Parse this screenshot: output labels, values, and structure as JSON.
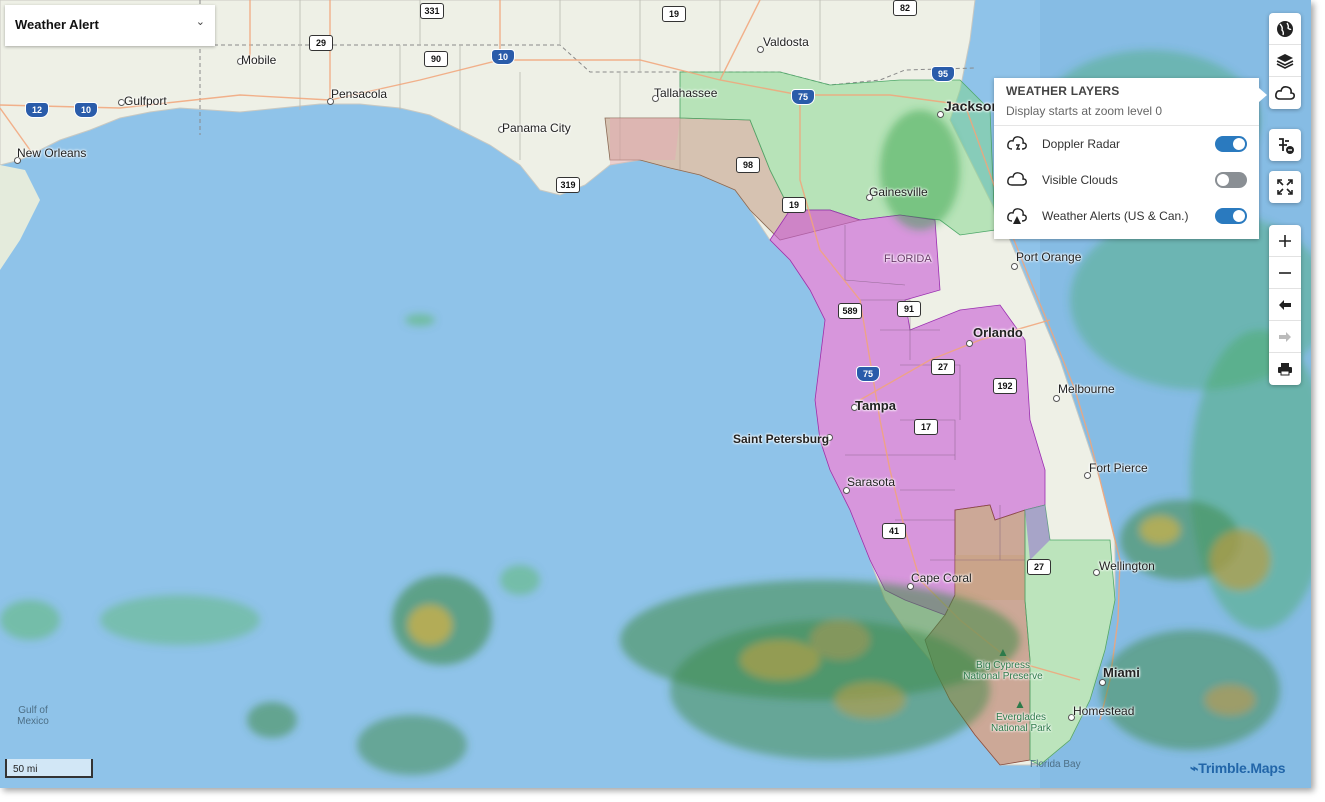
{
  "layer_select": {
    "label": "Weather Alert"
  },
  "weather_panel": {
    "title": "WEATHER LAYERS",
    "subtitle": "Display starts at zoom level 0",
    "layers": [
      {
        "name": "Doppler Radar",
        "enabled": true,
        "icon": "radar-cloud-icon"
      },
      {
        "name": "Visible Clouds",
        "enabled": false,
        "icon": "cloud-icon"
      },
      {
        "name": "Weather Alerts (US & Can.)",
        "enabled": true,
        "icon": "alert-cloud-icon"
      }
    ]
  },
  "toolbar": {
    "top": [
      "globe-icon",
      "layers-icon",
      "cloud-icon"
    ],
    "mid": [
      "traffic-icon",
      "fullscreen-icon"
    ],
    "nav": [
      "zoom-in-icon",
      "zoom-out-icon",
      "back-arrow-icon",
      "forward-arrow-icon",
      "print-icon"
    ]
  },
  "map": {
    "cities": {
      "mobile": "Mobile",
      "gulfport": "Gulfport",
      "new_orleans": "New Orleans",
      "pensacola": "Pensacola",
      "panama_city": "Panama City",
      "tallahassee": "Tallahassee",
      "valdosta": "Valdosta",
      "jacksonville": "Jackson",
      "gainesville": "Gainesville",
      "port_orange": "Port Orange",
      "orlando": "Orlando",
      "melbourne": "Melbourne",
      "tampa": "Tampa",
      "saint_petersburg": "Saint Petersburg",
      "fort_pierce": "Fort Pierce",
      "sarasota": "Sarasota",
      "wellington": "Wellington",
      "cape_coral": "Cape Coral",
      "miami": "Miami",
      "homestead": "Homestead"
    },
    "state_label": "FLORIDA",
    "parks": {
      "big_cypress": "Big Cypress\nNational Preserve",
      "everglades": "Everglades\nNational Park"
    },
    "water": {
      "gulf": "Gulf of\nMexico",
      "florida_bay": "Florida Bay"
    },
    "shields": {
      "s331": "331",
      "s19a": "19",
      "s82": "82",
      "s29": "29",
      "s90": "90",
      "i10": "10",
      "i12": "12",
      "i10b": "10",
      "i75a": "75",
      "i95": "95",
      "s98": "98",
      "s319": "319",
      "s19b": "19",
      "s589": "589",
      "s91": "91",
      "i75b": "75",
      "s27a": "27",
      "s192": "192",
      "s17": "17",
      "s41": "41",
      "s27b": "27"
    },
    "colors": {
      "water": "#8fc3e9",
      "land": "#eef0e6",
      "alert_magenta": "#c85ad6",
      "alert_brown": "#b88a70",
      "alert_green": "#7fd58a",
      "radar_green": "#5fb26a"
    }
  },
  "scale": {
    "label": "50 mi"
  },
  "attribution": {
    "label": "Trimble.Maps"
  }
}
